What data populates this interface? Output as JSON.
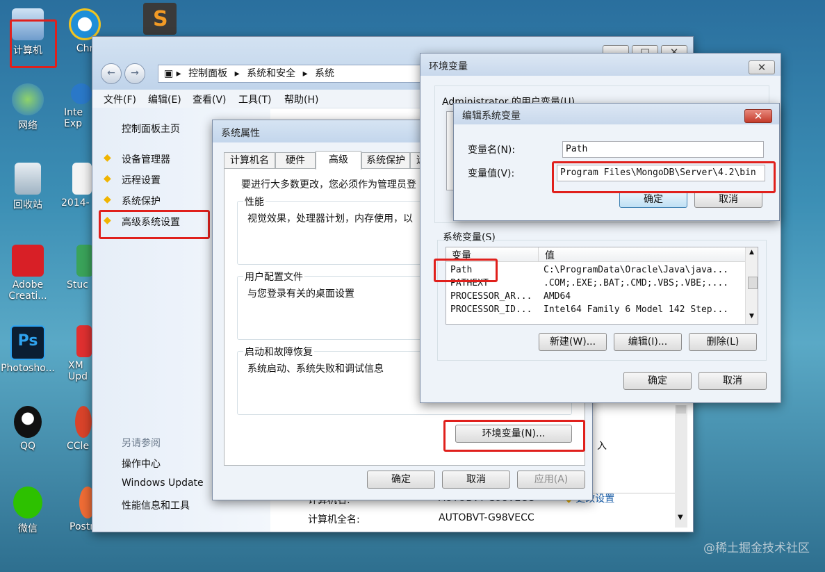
{
  "desktop": {
    "icons": [
      {
        "label": "计算机"
      },
      {
        "label": "Chr"
      },
      {
        "label": "网络"
      },
      {
        "label": "Inte Exp"
      },
      {
        "label": "回收站"
      },
      {
        "label": "2014-"
      },
      {
        "label": "Adobe Creati..."
      },
      {
        "label": "Stuc"
      },
      {
        "label": "Photosho..."
      },
      {
        "label": "XM Upd"
      },
      {
        "label": "QQ"
      },
      {
        "label": "CCle"
      },
      {
        "label": "微信"
      },
      {
        "label": "Postman"
      }
    ],
    "watermark": "@稀土掘金技术社区"
  },
  "explorer": {
    "breadcrumb": [
      "控制面板",
      "系统和安全",
      "系统"
    ],
    "menu": [
      "文件(F)",
      "编辑(E)",
      "查看(V)",
      "工具(T)",
      "帮助(H)"
    ],
    "sidebar_home": "控制面板主页",
    "sidebar_links": [
      "设备管理器",
      "远程设置",
      "系统保护",
      "高级系统设置"
    ],
    "see_also_title": "另请参阅",
    "see_also": [
      "操作中心",
      "Windows Update",
      "性能信息和工具"
    ],
    "info_rows": [
      {
        "key": "计算机名:",
        "value": "AUTOBVT-G98VECC",
        "link": "更改设置"
      },
      {
        "key": "计算机全名:",
        "value": "AUTOBVT-G98VECC"
      }
    ],
    "partial_text": "入"
  },
  "sysprops": {
    "title": "系统属性",
    "tabs": [
      "计算机名",
      "硬件",
      "高级",
      "系统保护",
      "远"
    ],
    "active_tab": "高级",
    "intro": "要进行大多数更改，您必须作为管理员登",
    "groups": [
      {
        "title": "性能",
        "desc": "视觉效果，处理器计划，内存使用，以"
      },
      {
        "title": "用户配置文件",
        "desc": "与您登录有关的桌面设置"
      },
      {
        "title": "启动和故障恢复",
        "desc": "系统启动、系统失败和调试信息"
      }
    ],
    "env_button": "环境变量(N)...",
    "ok": "确定",
    "cancel": "取消",
    "apply": "应用(A)"
  },
  "envvars": {
    "title": "环境变量",
    "user_group_label": "Administrator 的用户变量(U)",
    "sys_group_label": "系统变量(S)",
    "columns": [
      "变量",
      "值"
    ],
    "rows": [
      {
        "name": "Path",
        "value": "C:\\ProgramData\\Oracle\\Java\\java..."
      },
      {
        "name": "PATHEXT",
        "value": ".COM;.EXE;.BAT;.CMD;.VBS;.VBE;...."
      },
      {
        "name": "PROCESSOR_AR...",
        "value": "AMD64"
      },
      {
        "name": "PROCESSOR_ID...",
        "value": "Intel64 Family 6 Model 142 Step..."
      }
    ],
    "new_btn": "新建(W)...",
    "edit_btn": "编辑(I)...",
    "delete_btn": "删除(L)",
    "ok": "确定",
    "cancel": "取消"
  },
  "editvar": {
    "title": "编辑系统变量",
    "name_label": "变量名(N):",
    "value_label": "变量值(V):",
    "name_value": "Path",
    "value_value": "Program Files\\MongoDB\\Server\\4.2\\bin",
    "ok": "确定",
    "cancel": "取消"
  }
}
